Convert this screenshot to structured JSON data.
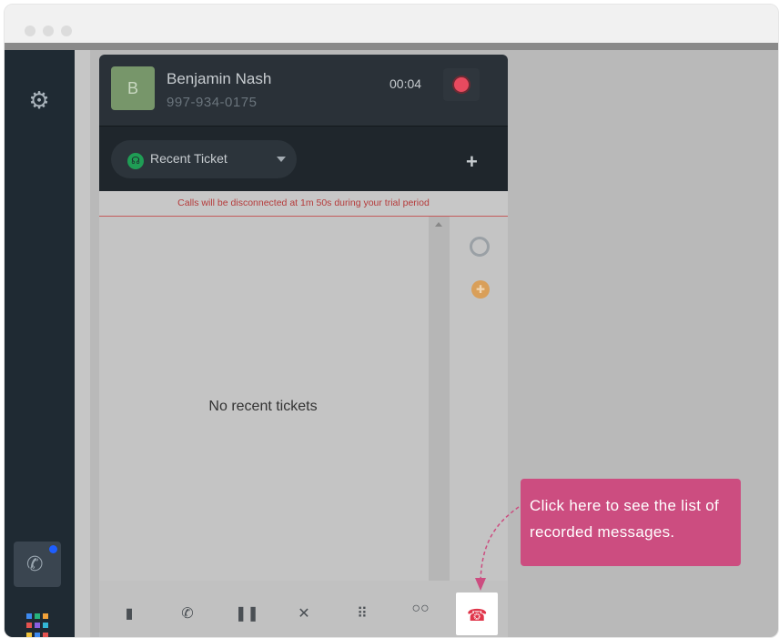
{
  "caller": {
    "avatar_letter": "B",
    "name": "Benjamin Nash",
    "phone": "997-934-0175",
    "timer": "00:04"
  },
  "ticket_selector": {
    "label": "Recent Ticket",
    "icon": "headset-icon",
    "add_icon": "plus-icon"
  },
  "trial_notice": "Calls will be disconnected at 1m 50s during your trial period",
  "empty_state": "No recent tickets",
  "tooltip": {
    "text": "Click here to see the list of recorded messages."
  },
  "sidebar": {
    "icons": [
      "gear-icon",
      "phone-icon",
      "apps-grid-icon"
    ],
    "accent": "#1e5eff"
  },
  "toolbar": {
    "icons": [
      "notes-icon",
      "transfer-call-icon",
      "pause-icon",
      "mute-icon",
      "keypad-icon",
      "voicemail-icon",
      "hangup-icon"
    ]
  },
  "colors": {
    "tooltip": "#cc4d80",
    "record": "#e84a5f",
    "hangup": "#e0354a",
    "ticket_icon": "#1f9d55"
  }
}
